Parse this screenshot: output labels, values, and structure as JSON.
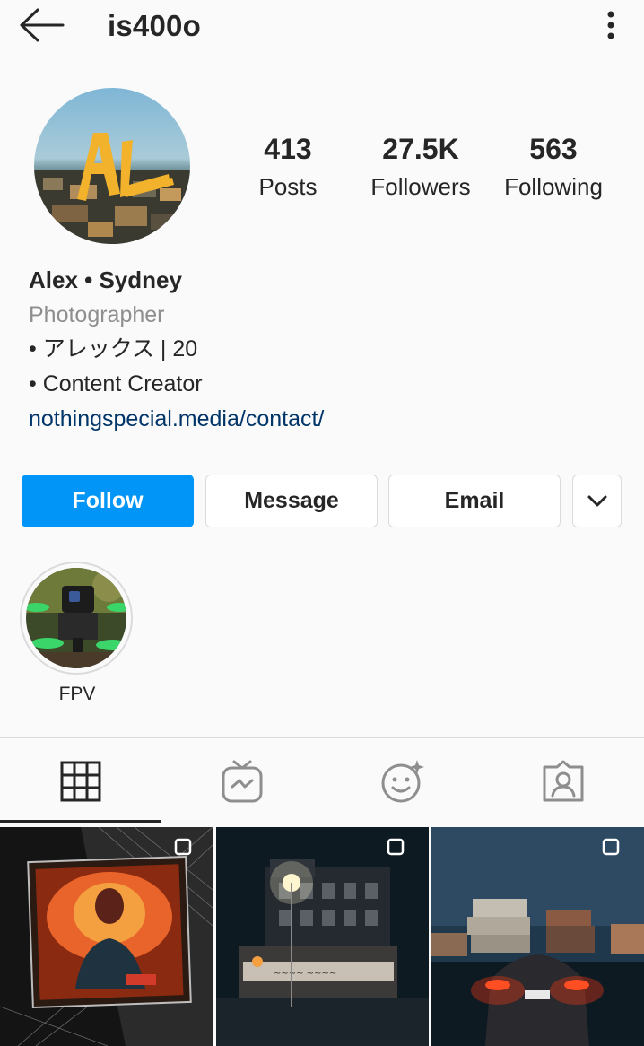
{
  "header": {
    "username": "is400o",
    "back_icon": "arrow-left-icon",
    "menu_icon": "more-vertical-icon"
  },
  "profile": {
    "avatar_icon": "profile-avatar",
    "stats": [
      {
        "count": "413",
        "label": "Posts"
      },
      {
        "count": "27.5K",
        "label": "Followers"
      },
      {
        "count": "563",
        "label": "Following"
      }
    ],
    "name": "Alex • Sydney",
    "category": "Photographer",
    "bio_lines": [
      "• アレックス | 20",
      "• Content Creator"
    ],
    "link": "nothingspecial.media/contact/"
  },
  "actions": {
    "follow_label": "Follow",
    "message_label": "Message",
    "email_label": "Email",
    "dropdown_icon": "chevron-down-icon"
  },
  "highlights": [
    {
      "label": "FPV"
    }
  ],
  "tabs": [
    {
      "icon": "grid-icon",
      "active": true
    },
    {
      "icon": "igtv-icon",
      "active": false
    },
    {
      "icon": "effects-icon",
      "active": false
    },
    {
      "icon": "tagged-icon",
      "active": false
    }
  ],
  "posts": [
    {
      "multi": true
    },
    {
      "multi": true
    },
    {
      "multi": true
    }
  ],
  "colors": {
    "accent": "#0095f6",
    "link": "#003569",
    "text": "#262626",
    "muted": "#8e8e8e",
    "border": "#dbdbdb",
    "background": "#fafafa"
  }
}
